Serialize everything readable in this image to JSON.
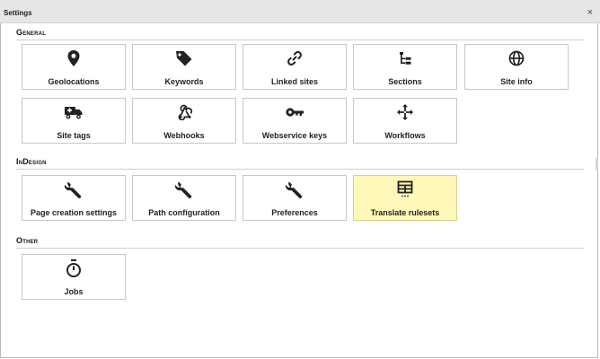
{
  "window": {
    "title": "Settings",
    "close_glyph": "×"
  },
  "sections": [
    {
      "heading": "General",
      "tiles": [
        {
          "label": "Geolocations",
          "icon": "map-pin-icon"
        },
        {
          "label": "Keywords",
          "icon": "tag-icon"
        },
        {
          "label": "Linked sites",
          "icon": "link-icon"
        },
        {
          "label": "Sections",
          "icon": "tree-icon"
        },
        {
          "label": "Site info",
          "icon": "globe-icon"
        },
        {
          "label": "Site tags",
          "icon": "truck-icon"
        },
        {
          "label": "Webhooks",
          "icon": "webhook-icon"
        },
        {
          "label": "Webservice keys",
          "icon": "key-icon"
        },
        {
          "label": "Workflows",
          "icon": "move-arrows-icon"
        }
      ]
    },
    {
      "heading": "InDesign",
      "tiles": [
        {
          "label": "Page creation settings",
          "icon": "wrench-icon"
        },
        {
          "label": "Path configuration",
          "icon": "wrench-icon"
        },
        {
          "label": "Preferences",
          "icon": "wrench-icon"
        },
        {
          "label": "Translate rulesets",
          "icon": "table-icon",
          "highlighted": true
        }
      ]
    },
    {
      "heading": "Other",
      "tiles": [
        {
          "label": "Jobs",
          "icon": "stopwatch-icon"
        }
      ]
    }
  ],
  "colors": {
    "highlight_tile": "#fff8b8",
    "titlebar": "#e6e6e6",
    "border": "#c7c7c7"
  }
}
